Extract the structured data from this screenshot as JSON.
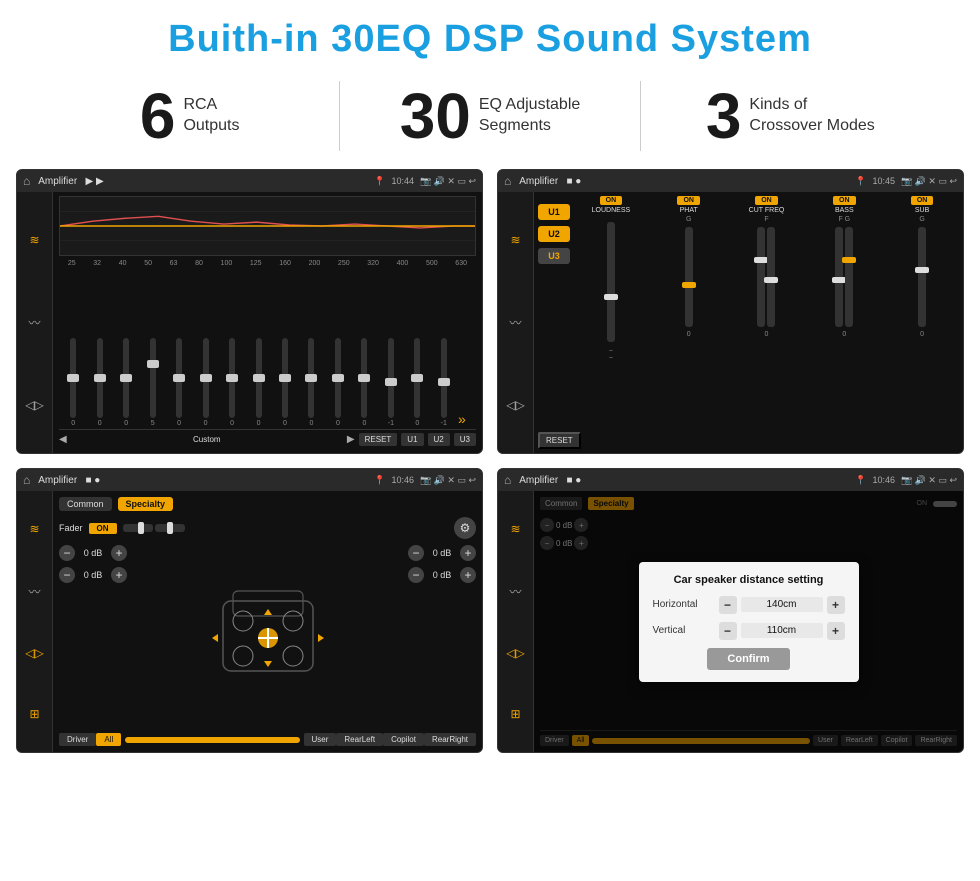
{
  "page": {
    "title": "Buith-in 30EQ DSP Sound System",
    "background": "#ffffff"
  },
  "stats": [
    {
      "number": "6",
      "label": "RCA\nOutputs"
    },
    {
      "number": "30",
      "label": "EQ Adjustable\nSegments"
    },
    {
      "number": "3",
      "label": "Kinds of\nCrossover Modes"
    }
  ],
  "screens": {
    "screen1": {
      "title": "Amplifier",
      "time": "10:44",
      "freqs": [
        "25",
        "32",
        "40",
        "50",
        "63",
        "80",
        "100",
        "125",
        "160",
        "200",
        "250",
        "320",
        "400",
        "500",
        "630"
      ],
      "values": [
        "0",
        "0",
        "0",
        "5",
        "0",
        "0",
        "0",
        "0",
        "0",
        "0",
        "0",
        "0",
        "-1",
        "0",
        "-1"
      ],
      "buttons": [
        "Custom",
        "RESET",
        "U1",
        "U2",
        "U3"
      ]
    },
    "screen2": {
      "title": "Amplifier",
      "time": "10:45",
      "presets": [
        "U1",
        "U2",
        "U3"
      ],
      "controls": [
        "LOUDNESS",
        "PHAT",
        "CUT FREQ",
        "BASS",
        "SUB"
      ],
      "resetBtn": "RESET"
    },
    "screen3": {
      "title": "Amplifier",
      "time": "10:46",
      "tabs": [
        "Common",
        "Specialty"
      ],
      "faderLabel": "Fader",
      "faderOn": "ON",
      "volumes": [
        "0 dB",
        "0 dB",
        "0 dB",
        "0 dB"
      ],
      "bottomBtns": [
        "Driver",
        "All",
        "User",
        "RearLeft",
        "RearRight",
        "Copilot"
      ]
    },
    "screen4": {
      "title": "Amplifier",
      "time": "10:46",
      "tabs": [
        "Common",
        "Specialty"
      ],
      "dialog": {
        "title": "Car speaker distance setting",
        "fields": [
          {
            "label": "Horizontal",
            "value": "140cm"
          },
          {
            "label": "Vertical",
            "value": "110cm"
          }
        ],
        "confirmBtn": "Confirm"
      },
      "volumes": [
        "0 dB",
        "0 dB"
      ],
      "bottomBtns": [
        "Driver",
        "Copilot",
        "RearLeft",
        "All",
        "User",
        "RearRight"
      ]
    }
  }
}
